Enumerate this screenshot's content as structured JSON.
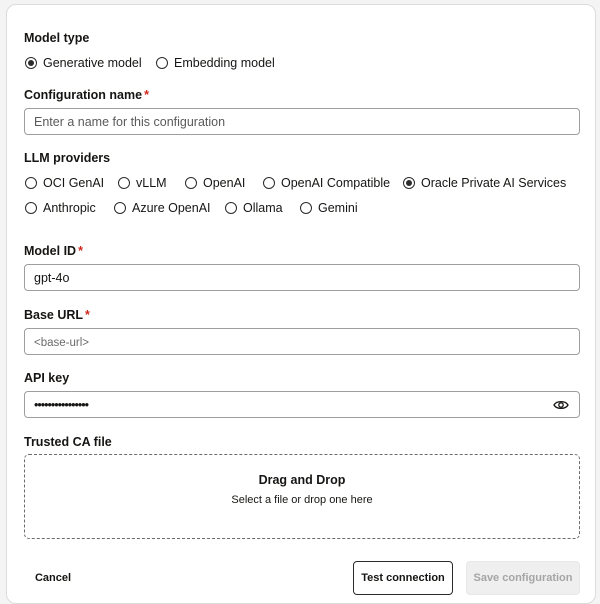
{
  "model_type": {
    "label": "Model type",
    "options": [
      {
        "label": "Generative model",
        "checked": true
      },
      {
        "label": "Embedding model",
        "checked": false
      }
    ]
  },
  "config_name": {
    "label": "Configuration name",
    "required_mark": "*",
    "placeholder": "Enter a name for this configuration"
  },
  "llm_providers": {
    "label": "LLM providers",
    "options": [
      {
        "label": "OCI GenAI",
        "checked": false
      },
      {
        "label": "vLLM",
        "checked": false
      },
      {
        "label": "OpenAI",
        "checked": false
      },
      {
        "label": "OpenAI Compatible",
        "checked": false
      },
      {
        "label": "Oracle Private AI Services",
        "checked": true
      },
      {
        "label": "Anthropic",
        "checked": false
      },
      {
        "label": "Azure OpenAI",
        "checked": false
      },
      {
        "label": "Ollama",
        "checked": false
      },
      {
        "label": "Gemini",
        "checked": false
      }
    ]
  },
  "model_id": {
    "label": "Model ID",
    "required_mark": "*",
    "value": "gpt-4o"
  },
  "base_url": {
    "label": "Base URL",
    "required_mark": "*",
    "placeholder": "<base-url>"
  },
  "api_key": {
    "label": "API key",
    "value": "••••••••••••••••"
  },
  "trusted_ca": {
    "label": "Trusted CA file",
    "title": "Drag and Drop",
    "subtitle": "Select a file or drop one here"
  },
  "actions": {
    "cancel": "Cancel",
    "test": "Test connection",
    "save": "Save configuration"
  },
  "icons": {
    "reveal": "eye-icon"
  }
}
